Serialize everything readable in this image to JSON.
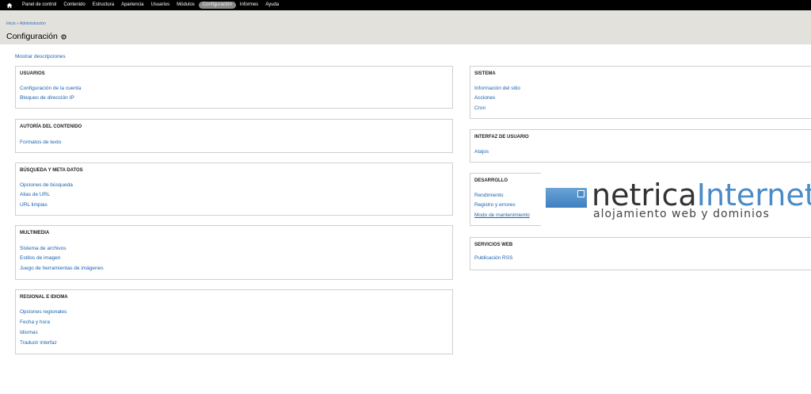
{
  "toolbar": {
    "items": [
      {
        "label": "Panel de control"
      },
      {
        "label": "Contenido"
      },
      {
        "label": "Estructura"
      },
      {
        "label": "Apariencia"
      },
      {
        "label": "Usuarios"
      },
      {
        "label": "Módulos"
      },
      {
        "label": "Configuración",
        "active": true
      },
      {
        "label": "Informes"
      },
      {
        "label": "Ayuda"
      }
    ]
  },
  "header": {
    "breadcrumb": "Inicio » Administración",
    "title": "Configuración"
  },
  "show_descriptions": "Mostrar descripciones",
  "left_panels": [
    {
      "title": "USUARIOS",
      "links": [
        "Configuración de la cuenta",
        "Bloqueo de dirección IP"
      ]
    },
    {
      "title": "AUTORÍA DEL CONTENIDO",
      "links": [
        "Formatos de texto"
      ]
    },
    {
      "title": "BÚSQUEDA Y META DATOS",
      "links": [
        "Opciones de búsqueda",
        "Alias de URL",
        "URL limpias"
      ]
    },
    {
      "title": "MULTIMEDIA",
      "links": [
        "Sistema de archivos",
        "Estilos de imagen",
        "Juego de herramientas de imágenes"
      ]
    },
    {
      "title": "REGIONAL E IDIOMA",
      "links": [
        "Opciones regionales",
        "Fecha y hora",
        "Idiomas",
        "Traducir interfaz"
      ]
    }
  ],
  "right_panels": [
    {
      "title": "SISTEMA",
      "links": [
        "Información del sitio",
        "Acciones",
        "Cron"
      ]
    },
    {
      "title": "INTERFAZ DE USUARIO",
      "links": [
        "Atajos"
      ]
    },
    {
      "title": "DESARROLLO",
      "links": [
        "Rendimiento",
        "Registro y errores",
        "Modo de mantenimiento"
      ]
    },
    {
      "title": "SERVICIOS WEB",
      "links": [
        "Publicación RSS"
      ]
    }
  ],
  "logo": {
    "word_main": "netrica",
    "word_accent": "Internet",
    "tagline": "alojamiento web y dominios"
  },
  "colors": {
    "link": "#1a63b0",
    "toolbar_bg": "#000000",
    "header_bg": "#e2e1dc",
    "logo_accent": "#4a8bc8"
  }
}
